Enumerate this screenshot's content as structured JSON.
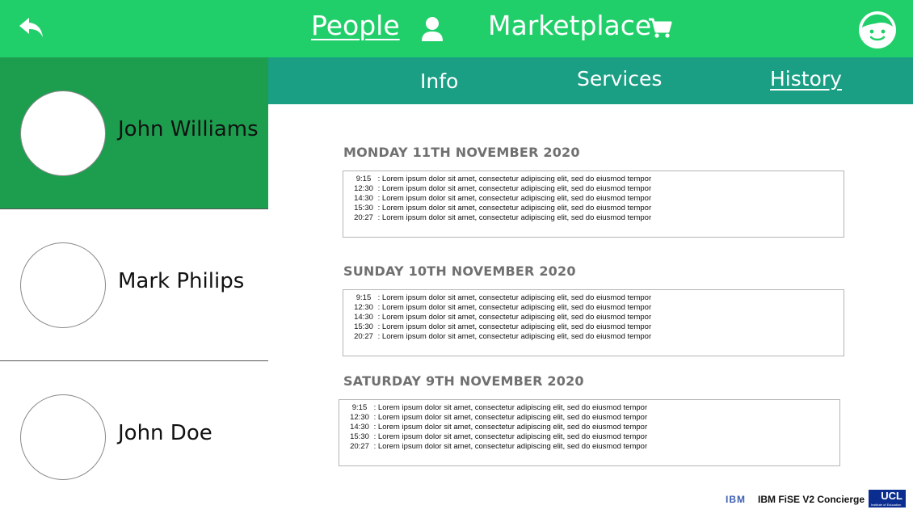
{
  "header": {
    "people_label": "People",
    "marketplace_label": "Marketplace",
    "icons": [
      "back-arrow-icon",
      "person-icon",
      "cart-icon",
      "face-icon"
    ],
    "colors": {
      "topbar": "#21cf6a",
      "tabs": "#1a9e84",
      "active_contact": "#1d9e4f"
    }
  },
  "sidebar": {
    "contacts": [
      {
        "name": "John Williams",
        "active": true
      },
      {
        "name": "Mark Philips",
        "active": false
      },
      {
        "name": "John Doe",
        "active": false
      }
    ]
  },
  "tabs": [
    {
      "label": "Info"
    },
    {
      "label": "Services"
    },
    {
      "label": "History",
      "active": true
    }
  ],
  "history": [
    {
      "date": "MONDAY 11TH NOVEMBER 2020",
      "entries": [
        {
          "time": "9:15",
          "text": "Lorem ipsum dolor sit amet, consectetur adipiscing elit, sed do eiusmod tempor"
        },
        {
          "time": "12:30",
          "text": "Lorem ipsum dolor sit amet, consectetur adipiscing elit, sed do eiusmod tempor"
        },
        {
          "time": "14:30",
          "text": "Lorem ipsum dolor sit amet, consectetur adipiscing elit, sed do eiusmod tempor"
        },
        {
          "time": "15:30",
          "text": "Lorem ipsum dolor sit amet, consectetur adipiscing elit, sed do eiusmod tempor"
        },
        {
          "time": "20:27",
          "text": "Lorem ipsum dolor sit amet, consectetur adipiscing elit, sed do eiusmod tempor"
        }
      ]
    },
    {
      "date": "SUNDAY 10TH NOVEMBER 2020",
      "entries": [
        {
          "time": "9:15",
          "text": "Lorem ipsum dolor sit amet, consectetur adipiscing elit, sed do eiusmod tempor"
        },
        {
          "time": "12:30",
          "text": "Lorem ipsum dolor sit amet, consectetur adipiscing elit, sed do eiusmod tempor"
        },
        {
          "time": "14:30",
          "text": "Lorem ipsum dolor sit amet, consectetur adipiscing elit, sed do eiusmod tempor"
        },
        {
          "time": "15:30",
          "text": "Lorem ipsum dolor sit amet, consectetur adipiscing elit, sed do eiusmod tempor"
        },
        {
          "time": "20:27",
          "text": "Lorem ipsum dolor sit amet, consectetur adipiscing elit, sed do eiusmod tempor"
        }
      ]
    },
    {
      "date": "SATURDAY 9TH NOVEMBER 2020",
      "entries": [
        {
          "time": "9:15",
          "text": "Lorem ipsum dolor sit amet, consectetur adipiscing elit, sed do eiusmod tempor"
        },
        {
          "time": "12:30",
          "text": "Lorem ipsum dolor sit amet, consectetur adipiscing elit, sed do eiusmod tempor"
        },
        {
          "time": "14:30",
          "text": "Lorem ipsum dolor sit amet, consectetur adipiscing elit, sed do eiusmod tempor"
        },
        {
          "time": "15:30",
          "text": "Lorem ipsum dolor sit amet, consectetur adipiscing elit, sed do eiusmod tempor"
        },
        {
          "time": "20:27",
          "text": "Lorem ipsum dolor sit amet, consectetur adipiscing elit, sed do eiusmod tempor"
        }
      ]
    }
  ],
  "footer": {
    "ibm_logo": "IBM",
    "app_label": "IBM FiSE V2 Concierge",
    "ucl_logo": "UCL",
    "ucl_subtitle": "Institute of Education"
  }
}
